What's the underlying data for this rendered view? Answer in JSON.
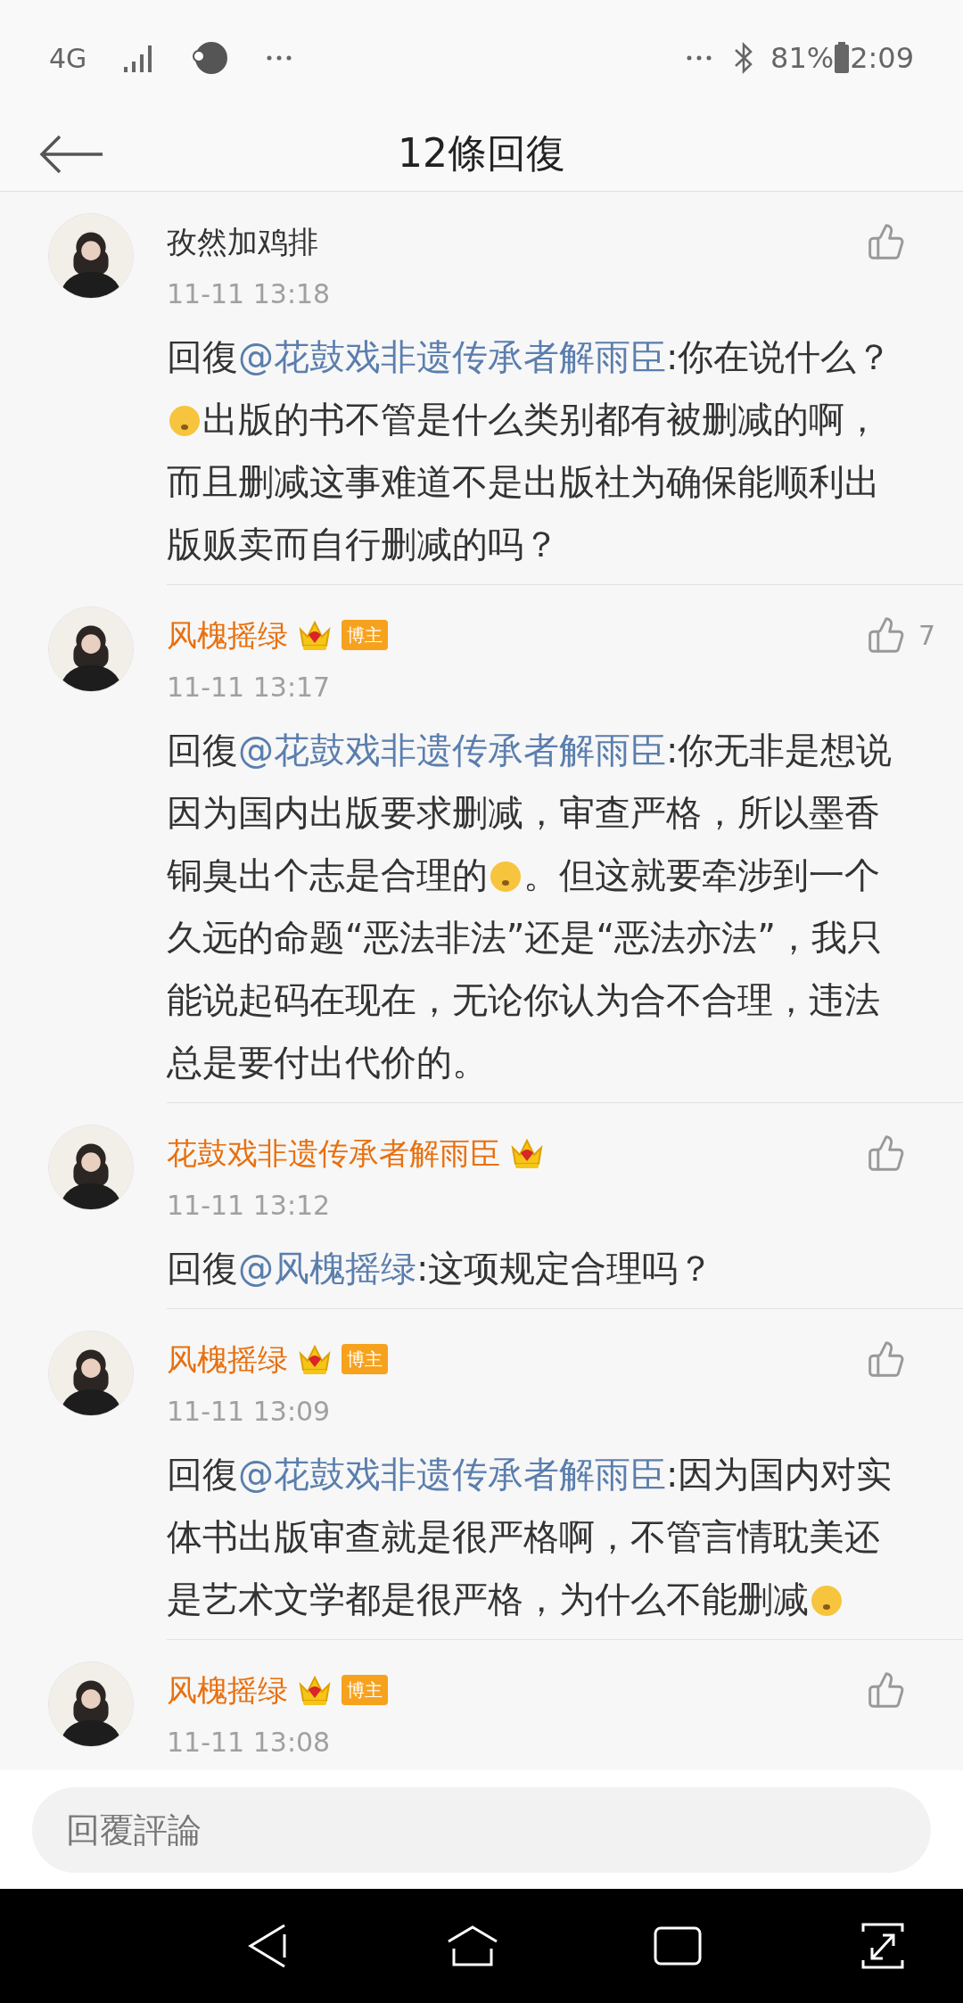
{
  "status_bar": {
    "network": "4G",
    "battery": "81%",
    "time": "2:09"
  },
  "header": {
    "title": "12條回復"
  },
  "comments": [
    {
      "author": "孜然加鸡排",
      "vip": false,
      "time": "11-11 13:18",
      "body": [
        {
          "kind": "text",
          "text": "回復"
        },
        {
          "kind": "mention",
          "text": "@花鼓戏非遗传承者解雨臣"
        },
        {
          "kind": "text",
          "text": ":你在说什么？"
        },
        {
          "kind": "emoji"
        },
        {
          "kind": "text",
          "text": "出版的书不管是什么类别都有被删减的啊，而且删减这事难道不是出版社为确保能顺利出版贩卖而自行删减的吗？"
        }
      ]
    },
    {
      "author": "风槐摇绿",
      "vip": true,
      "badge": "博主",
      "likes": "7",
      "time": "11-11 13:17",
      "body": [
        {
          "kind": "text",
          "text": "回復"
        },
        {
          "kind": "mention",
          "text": "@花鼓戏非遗传承者解雨臣"
        },
        {
          "kind": "text",
          "text": ":你无非是想说因为国内出版要求删减，审查严格，所以墨香铜臭出个志是合理的"
        },
        {
          "kind": "emoji"
        },
        {
          "kind": "text",
          "text": "。但这就要牵涉到一个久远的命题“恶法非法”还是“恶法亦法”，我只能说起码在现在，无论你认为合不合理，违法总是要付出代价的。"
        }
      ]
    },
    {
      "author": "花鼓戏非遗传承者解雨臣",
      "vip": true,
      "time": "11-11 13:12",
      "body": [
        {
          "kind": "text",
          "text": "回復"
        },
        {
          "kind": "mention",
          "text": "@风槐摇绿"
        },
        {
          "kind": "text",
          "text": ":这项规定合理吗？"
        }
      ]
    },
    {
      "author": "风槐摇绿",
      "vip": true,
      "badge": "博主",
      "time": "11-11 13:09",
      "body": [
        {
          "kind": "text",
          "text": "回復"
        },
        {
          "kind": "mention",
          "text": "@花鼓戏非遗传承者解雨臣"
        },
        {
          "kind": "text",
          "text": ":因为国内对实体书出版审查就是很严格啊，不管言情耽美还是艺术文学都是很严格，为什么不能删减"
        },
        {
          "kind": "emoji"
        }
      ]
    },
    {
      "author": "风槐摇绿",
      "vip": true,
      "badge": "博主",
      "time": "11-11 13:08"
    }
  ],
  "reply_field": {
    "placeholder": "回覆評論"
  }
}
